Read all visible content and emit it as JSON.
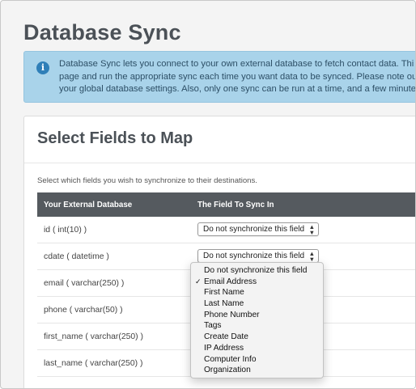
{
  "page": {
    "title": "Database Sync",
    "info_lines": [
      "Database Sync lets you connect to your own external database to fetch contact data. Thi",
      "page and run the appropriate sync each time you want data to be synced. Please note ou",
      "your global database settings. Also, only one sync can be run at a time, and a few minute"
    ]
  },
  "card": {
    "title": "Select Fields to Map",
    "description": "Select which fields you wish to synchronize to their destinations.",
    "columns": [
      "Your External Database",
      "The Field To Sync In"
    ],
    "rows": [
      {
        "field": "id ( int(10) )",
        "select": "Do not synchronize this field"
      },
      {
        "field": "cdate ( datetime )",
        "select": "Do not synchronize this field"
      },
      {
        "field": "email ( varchar(250) )",
        "select": ""
      },
      {
        "field": "phone ( varchar(50) )",
        "select": ""
      },
      {
        "field": "first_name ( varchar(250) )",
        "select": ""
      },
      {
        "field": "last_name ( varchar(250) )",
        "select": ""
      }
    ]
  },
  "dropdown": {
    "selected_index": 1,
    "check_mark": "✓",
    "options": [
      "Do not synchronize this field",
      "Email Address",
      "First Name",
      "Last Name",
      "Phone Number",
      "Tags",
      "Create Date",
      "IP Address",
      "Computer Info",
      "Organization"
    ]
  },
  "colors": {
    "info_bg": "#a9d3ea",
    "info_icon": "#2f7fb8",
    "table_header": "#555a5f"
  },
  "icons": {
    "info": "info-circle-icon",
    "select_arrows": "up-down-arrows-icon"
  }
}
